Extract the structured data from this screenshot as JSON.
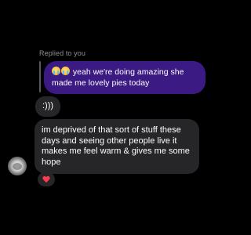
{
  "reply": {
    "label": "Replied to you",
    "quoted_emojis": [
      "loudly-crying-face-emoji",
      "loudly-crying-face-emoji"
    ],
    "quoted_text": " yeah we're doing amazing she made me lovely pies today"
  },
  "messages": [
    {
      "text": ":)))"
    },
    {
      "text": "im deprived of that sort of stuff these days and seeing other people live it makes me feel warm & gives me some hope"
    }
  ],
  "reaction": {
    "icon": "heart-icon"
  },
  "colors": {
    "background": "#000000",
    "quoted_bubble": "#3c1a84",
    "received_bubble": "#262628",
    "reaction_heart": "#ff3b4e",
    "secondary_text": "#8e8e93"
  }
}
